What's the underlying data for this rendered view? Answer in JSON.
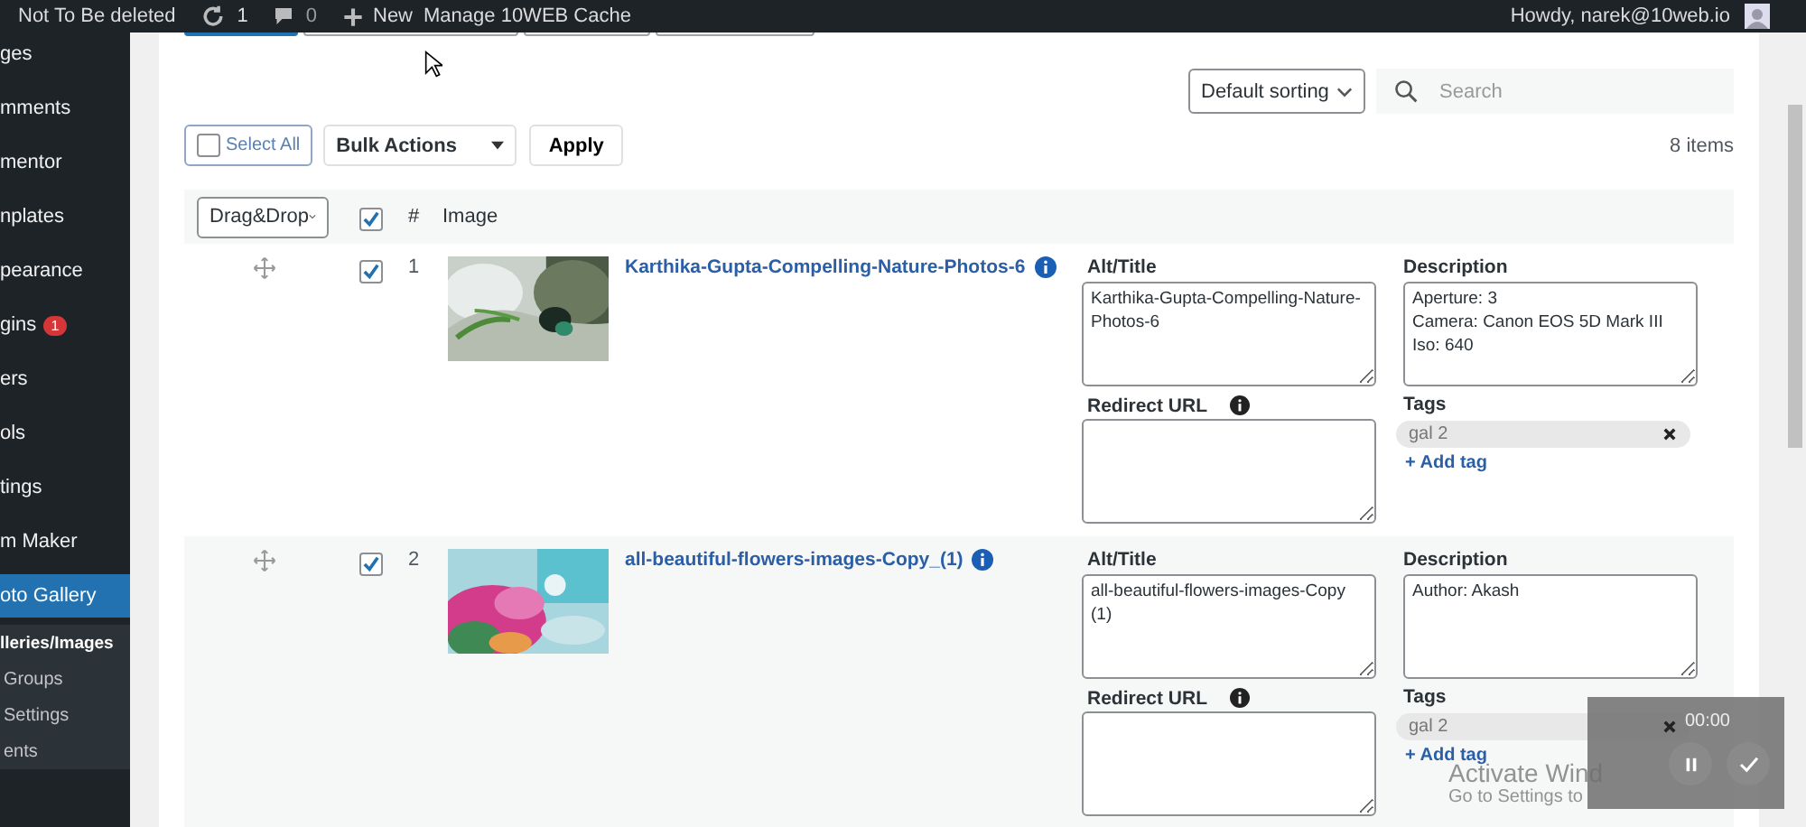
{
  "admin_bar": {
    "site": "Not To Be deleted",
    "updates": "1",
    "comments": "0",
    "new": "New",
    "cache": "Manage 10WEB Cache",
    "greeting": "Howdy, narek@10web.io"
  },
  "sidebar": {
    "items": [
      {
        "label": "ges",
        "kind": "menu",
        "selected": false
      },
      {
        "label": "mments",
        "kind": "menu",
        "selected": false
      },
      {
        "label": "mentor",
        "kind": "menu",
        "selected": false
      },
      {
        "label": "nplates",
        "kind": "menu",
        "selected": false
      },
      {
        "label": "pearance",
        "kind": "menu",
        "selected": false
      },
      {
        "label": "gins",
        "kind": "menu",
        "selected": false,
        "badge": "1"
      },
      {
        "label": "ers",
        "kind": "menu",
        "selected": false
      },
      {
        "label": "ols",
        "kind": "menu",
        "selected": false
      },
      {
        "label": "tings",
        "kind": "menu",
        "selected": false
      },
      {
        "label": "m Maker",
        "kind": "menu",
        "selected": false
      },
      {
        "label": "oto Gallery",
        "kind": "menu",
        "selected": true
      },
      {
        "label": "lleries/Images",
        "kind": "submenu",
        "selected": true
      },
      {
        "label": "Groups",
        "kind": "submenu",
        "selected": false
      },
      {
        "label": "Settings",
        "kind": "submenu",
        "selected": false
      },
      {
        "label": "ents",
        "kind": "submenu",
        "selected": false
      }
    ]
  },
  "toolbar": {
    "sorting": "Default sorting",
    "search_placeholder": "Search",
    "select_all": "Select All",
    "select_all_checked": false,
    "bulk_actions": "Bulk Actions",
    "apply": "Apply",
    "count": "8 items"
  },
  "table": {
    "order_mode": "Drag&Drop",
    "all_checked": true,
    "number_header": "#",
    "image_header": "Image",
    "rows": [
      {
        "number": "1",
        "checked": true,
        "kind": "picture",
        "title": "Karthika-Gupta-Compelling-Nature-Photos-6",
        "alt_label": "Alt/Title",
        "alt": "Karthika-Gupta-Compelling-Nature-Photos-6",
        "redirect_label": "Redirect URL",
        "desc_label": "Description",
        "description": "Aperture: 3\nCamera: Canon EOS 5D Mark III\nIso: 640",
        "tags_label": "Tags",
        "tags": [
          {
            "label": "gal 2"
          }
        ],
        "add_tag": "+ Add tag"
      },
      {
        "number": "2",
        "checked": true,
        "kind": "picture",
        "title": "all-beautiful-flowers-images-Copy_(1)",
        "alt_label": "Alt/Title",
        "alt": "all-beautiful-flowers-images-Copy (1)",
        "redirect_label": "Redirect URL",
        "desc_label": "Description",
        "description": "Author: Akash",
        "tags_label": "Tags",
        "tags": [
          {
            "label": "gal 2"
          }
        ],
        "add_tag": "+ Add tag"
      }
    ]
  },
  "windows_notice": {
    "title": "Activate Wind",
    "subtitle": "Go to Settings to"
  },
  "recorder": {
    "time": "00:00"
  }
}
